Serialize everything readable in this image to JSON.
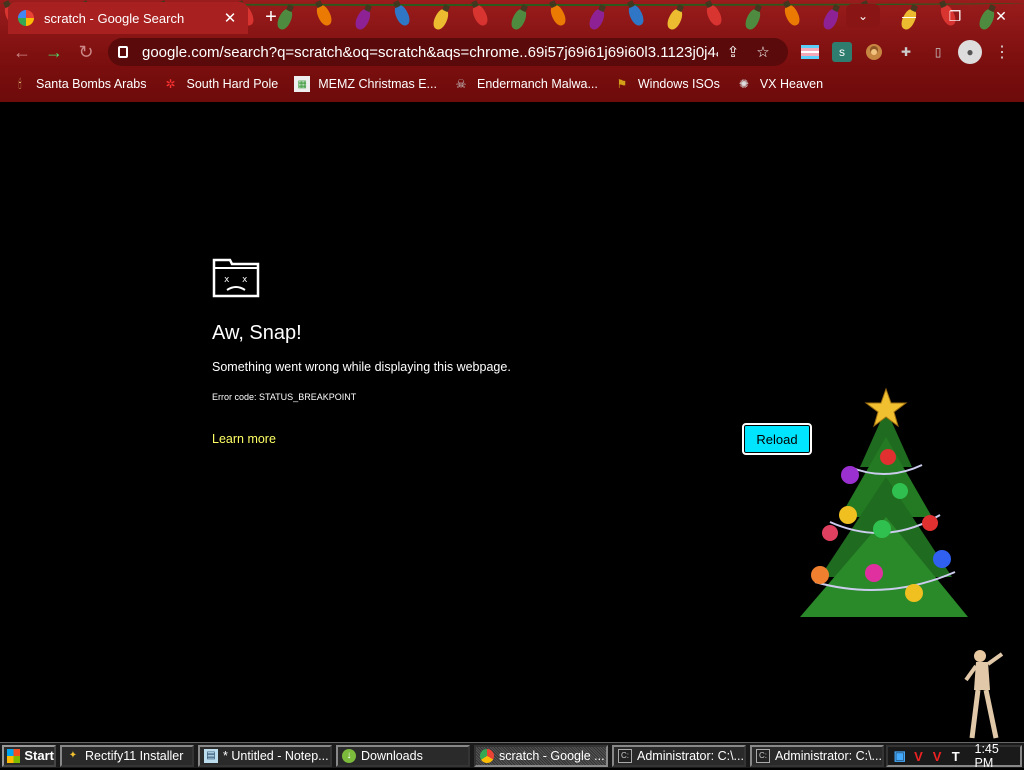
{
  "browser": {
    "tab_title": "scratch - Google Search",
    "url": "google.com/search?q=scratch&oq=scratch&aqs=chrome..69i57j69i61j69i60l3.1123j0j4&so...",
    "window_controls": {
      "minimize": "—",
      "restore": "❐",
      "close": "✕"
    },
    "bookmarks": [
      {
        "label": "Santa Bombs Arabs",
        "icon": "candle-icon"
      },
      {
        "label": "South Hard Pole",
        "icon": "snowflake-icon"
      },
      {
        "label": "MEMZ Christmas E...",
        "icon": "image-icon"
      },
      {
        "label": "Endermanch Malwa...",
        "icon": "skull-icon"
      },
      {
        "label": "Windows ISOs",
        "icon": "gift-icon"
      },
      {
        "label": "VX Heaven",
        "icon": "virus-icon"
      }
    ]
  },
  "error_page": {
    "title": "Aw, Snap!",
    "message": "Something went wrong while displaying this webpage.",
    "code": "Error code: STATUS_BREAKPOINT",
    "learn_more": "Learn more",
    "reload": "Reload"
  },
  "taskbar": {
    "start": "Start",
    "tasks": [
      {
        "label": "Rectify11 Installer",
        "icon": "installer-icon",
        "active": false
      },
      {
        "label": "* Untitled - Notep...",
        "icon": "notepad-icon",
        "active": false
      },
      {
        "label": "Downloads",
        "icon": "folder-icon",
        "active": false
      },
      {
        "label": "scratch - Google ...",
        "icon": "chrome-icon",
        "active": true
      },
      {
        "label": "Administrator: C:\\...",
        "icon": "cmd-icon",
        "active": false
      },
      {
        "label": "Administrator: C:\\...",
        "icon": "cmd-icon",
        "active": false
      }
    ],
    "clock": "1:45 PM"
  },
  "colors": {
    "chrome_red": "#8a1515",
    "reload_button": "#00e5ff",
    "learn_more_link": "#ffff66"
  }
}
